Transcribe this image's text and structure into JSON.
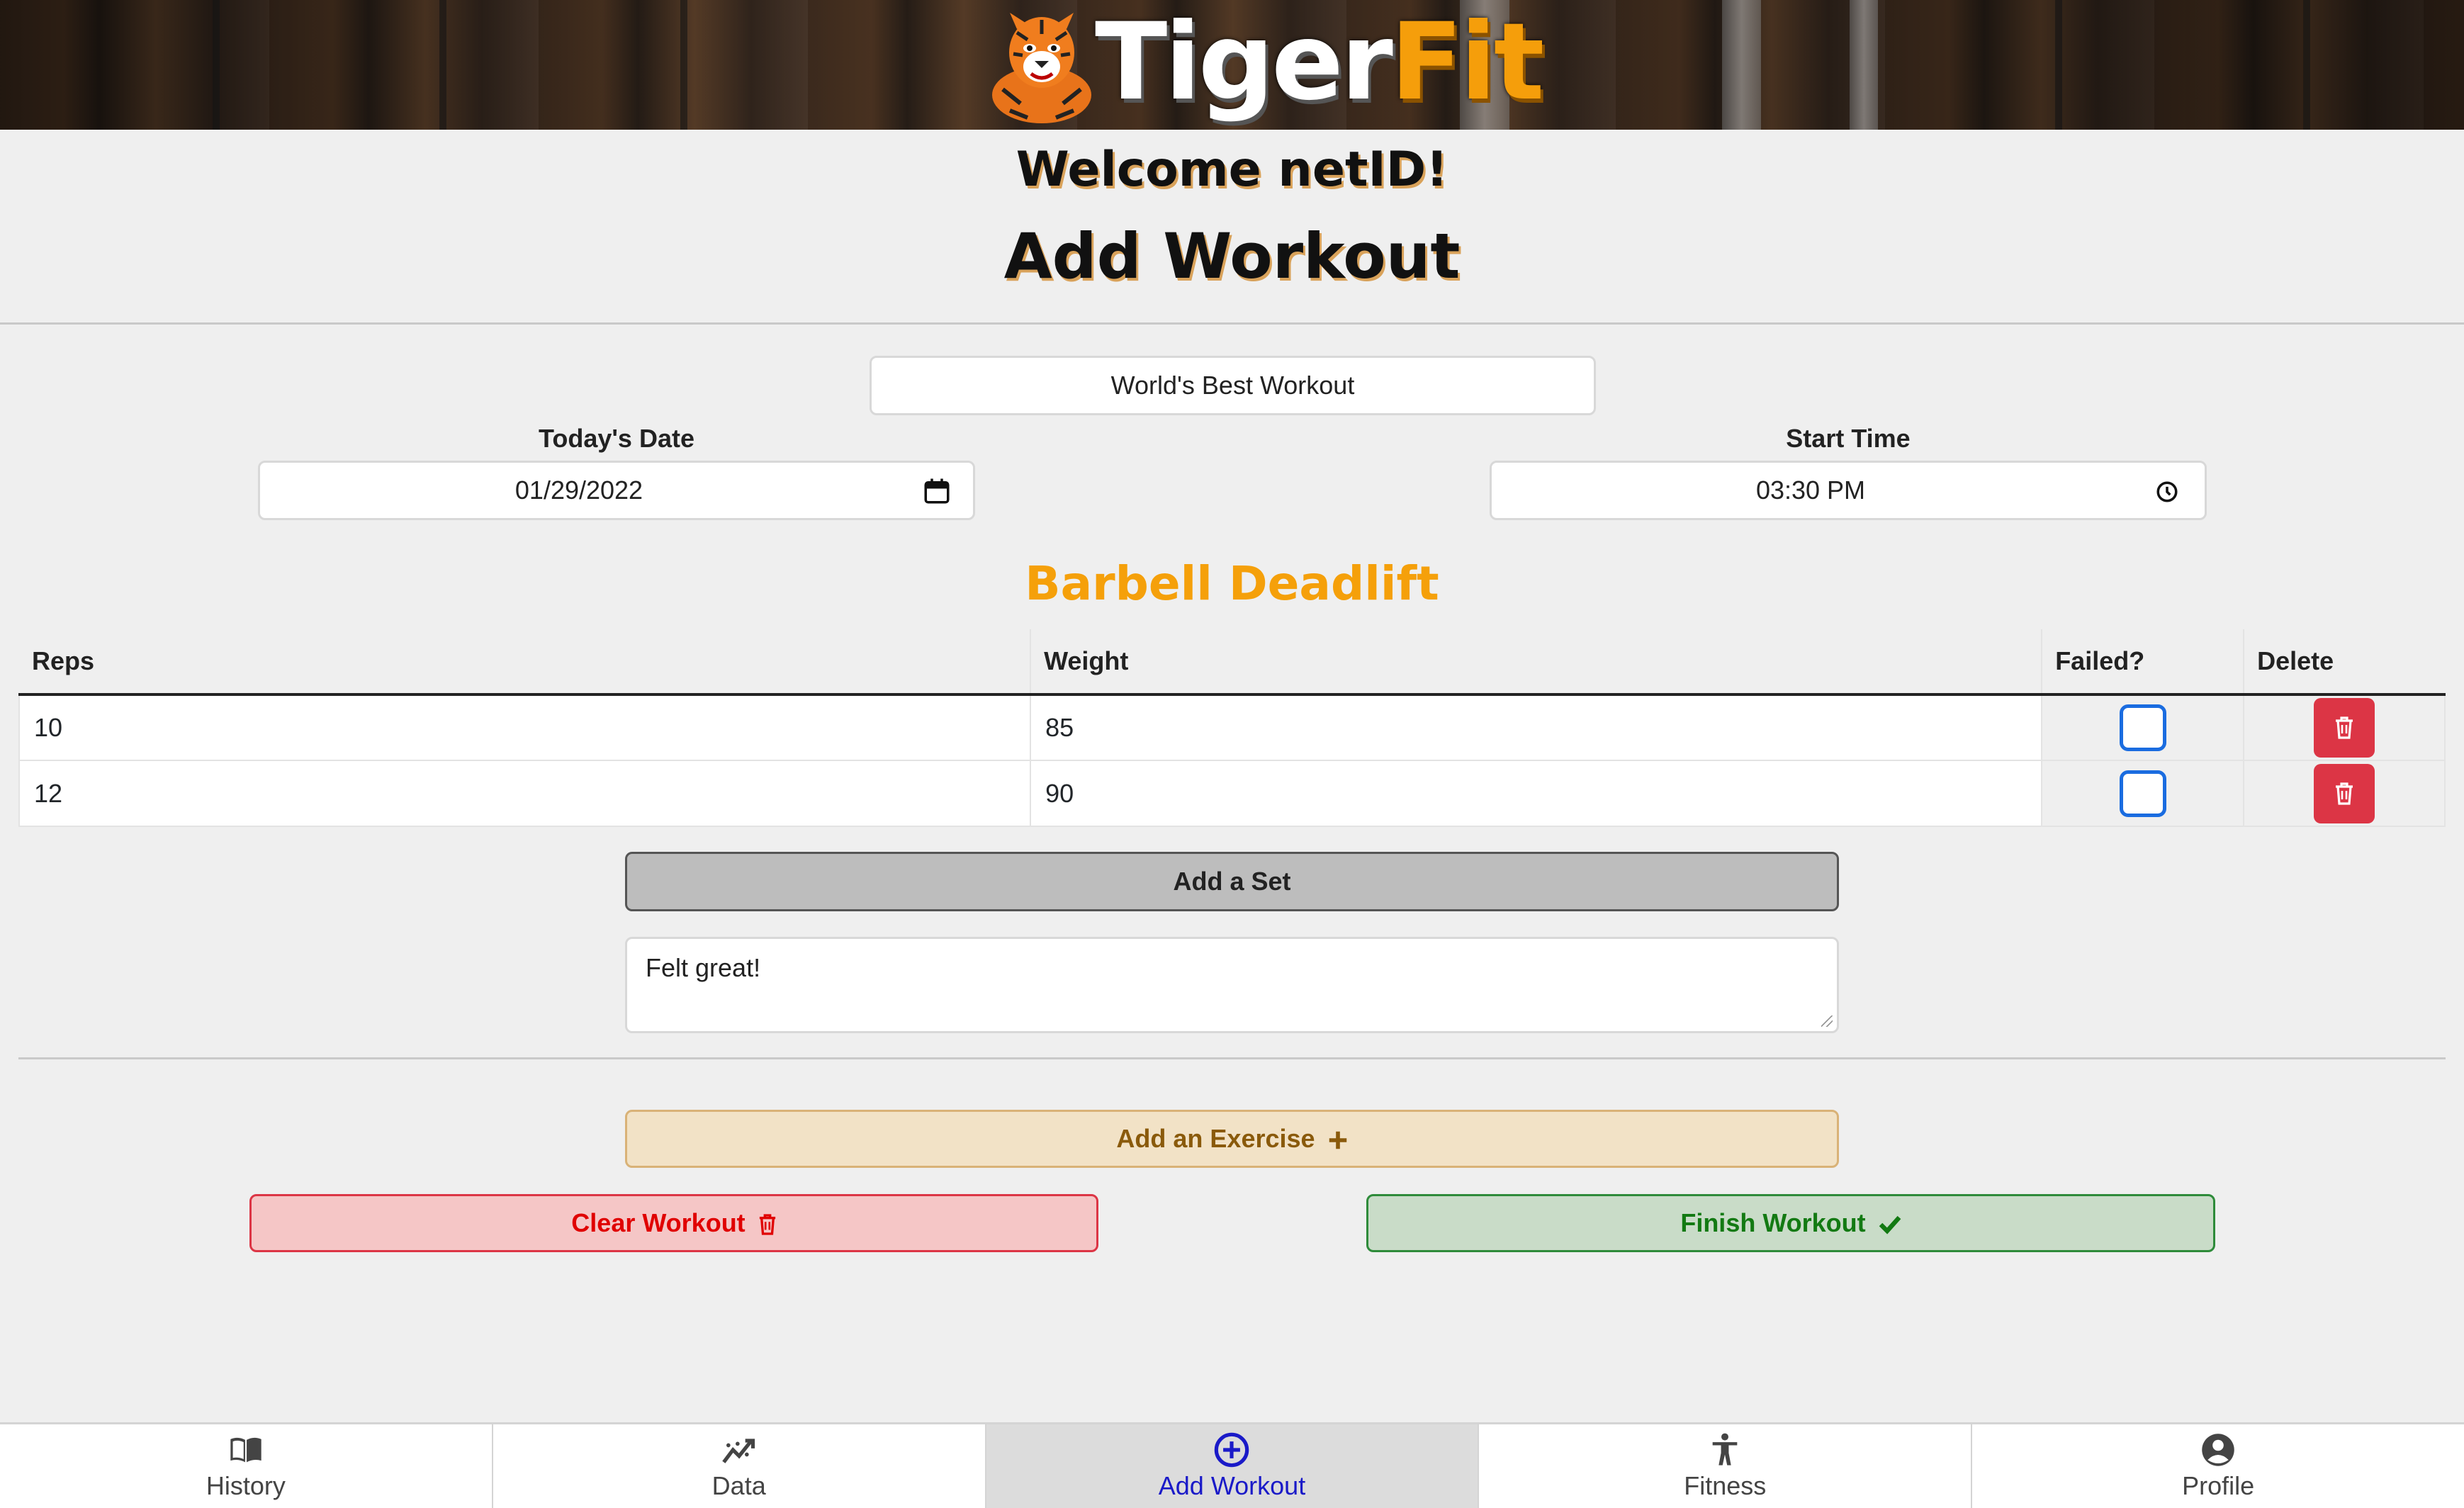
{
  "brand": {
    "name_part1": "Tiger",
    "name_part2": "Fit",
    "accent": "#f59e0b"
  },
  "header": {
    "welcome": "Welcome netID!",
    "title": "Add Workout"
  },
  "form": {
    "workout_name": "World's Best Workout",
    "date_label": "Today's Date",
    "date_value": "01/29/2022",
    "time_label": "Start Time",
    "time_value": "03:30 PM"
  },
  "exercise": {
    "name": "Barbell Deadlift",
    "columns": {
      "reps": "Reps",
      "weight": "Weight",
      "failed": "Failed?",
      "delete": "Delete"
    },
    "sets": [
      {
        "reps": "10",
        "weight": "85",
        "failed": false
      },
      {
        "reps": "12",
        "weight": "90",
        "failed": false
      }
    ],
    "add_set_label": "Add a Set",
    "notes": "Felt great!"
  },
  "actions": {
    "add_exercise": "Add an Exercise",
    "clear_workout": "Clear Workout",
    "finish_workout": "Finish Workout"
  },
  "nav": {
    "items": [
      {
        "label": "History",
        "icon": "book-icon"
      },
      {
        "label": "Data",
        "icon": "graph-icon"
      },
      {
        "label": "Add Workout",
        "icon": "plus-circle-icon",
        "active": true
      },
      {
        "label": "Fitness",
        "icon": "person-icon"
      },
      {
        "label": "Profile",
        "icon": "person-circle-icon"
      }
    ]
  }
}
